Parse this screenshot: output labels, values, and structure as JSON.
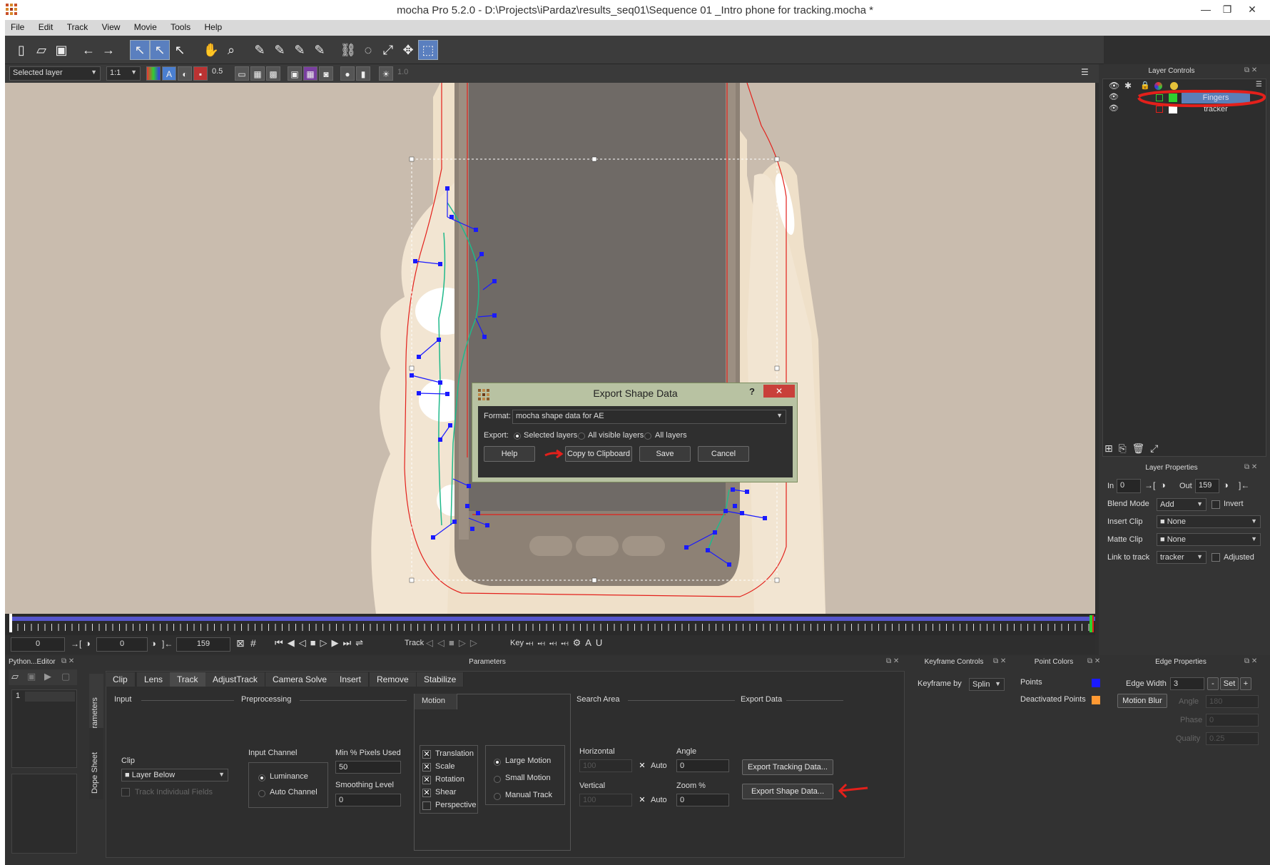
{
  "window": {
    "title": "mocha Pro 5.2.0 - D:\\Projects\\iPardaz\\results_seq01\\Sequence 01 _Intro phone for tracking.mocha *",
    "minimize": "—",
    "maximize": "❐",
    "close": "✕"
  },
  "menu": [
    "File",
    "Edit",
    "Track",
    "View",
    "Movie",
    "Tools",
    "Help"
  ],
  "view_toolbar": {
    "layer_mode": "Selected layer",
    "zoom": "1:1",
    "opacity": "0.5",
    "exposure": "1.0"
  },
  "layer_controls": {
    "title": "Layer Controls",
    "layers": [
      {
        "name": "Fingers",
        "color": "#2fd12f",
        "selected": true
      },
      {
        "name": "tracker",
        "color": "#ffffff",
        "selected": false
      }
    ]
  },
  "layer_properties": {
    "title": "Layer Properties",
    "in_label": "In",
    "in_value": "0",
    "out_label": "Out",
    "out_value": "159",
    "blend_mode_label": "Blend Mode",
    "blend_mode_value": "Add",
    "invert_label": "Invert",
    "insert_clip_label": "Insert Clip",
    "insert_clip_value": "None",
    "matte_clip_label": "Matte Clip",
    "matte_clip_value": "None",
    "link_to_track_label": "Link to track",
    "link_to_track_value": "tracker",
    "adjusted_label": "Adjusted"
  },
  "transport": {
    "start_frame": "0",
    "current_frame": "0",
    "end_frame": "159",
    "track_label": "Track",
    "key_label": "Key"
  },
  "bottom_panels": {
    "python_editor_title": "Python...Editor",
    "python_line": "1",
    "parameters_title": "Parameters",
    "side_tabs": [
      "Parameters",
      "Dope Sheet"
    ],
    "tabs": [
      "Clip",
      "Lens",
      "Track",
      "AdjustTrack",
      "Camera Solve",
      "Insert",
      "Remove",
      "Stabilize"
    ],
    "active_tab": "Track",
    "sections": {
      "input": "Input",
      "preprocessing": "Preprocessing",
      "motion": "Motion",
      "search_area": "Search Area",
      "export_data": "Export Data"
    },
    "clip_label": "Clip",
    "clip_value": "Layer Below",
    "track_individual_fields": "Track Individual Fields",
    "input_channel_label": "Input Channel",
    "luminance": "Luminance",
    "auto_channel": "Auto Channel",
    "min_pixels_label": "Min % Pixels Used",
    "min_pixels_value": "50",
    "smoothing_label": "Smoothing Level",
    "smoothing_value": "0",
    "motion_checks": [
      "Translation",
      "Scale",
      "Rotation",
      "Shear",
      "Perspective"
    ],
    "motion_types": [
      "Large Motion",
      "Small Motion",
      "Manual Track"
    ],
    "horizontal_label": "Horizontal",
    "horizontal_value": "100",
    "vertical_label": "Vertical",
    "vertical_value": "100",
    "auto_label": "Auto",
    "angle_label": "Angle",
    "angle_value": "0",
    "zoom_label": "Zoom %",
    "zoom_value": "0",
    "export_tracking": "Export Tracking Data...",
    "export_shape": "Export Shape Data..."
  },
  "keyframe_controls": {
    "title": "Keyframe Controls",
    "keyframe_by_label": "Keyframe by",
    "keyframe_by_value": "Splin"
  },
  "point_colors": {
    "title": "Point Colors",
    "points_label": "Points",
    "points_color": "#1a1aff",
    "deactivated_label": "Deactivated Points",
    "deactivated_color": "#ff9933"
  },
  "edge_properties": {
    "title": "Edge Properties",
    "edge_width_label": "Edge Width",
    "edge_width_value": "3",
    "minus": "-",
    "set": "Set",
    "plus": "+",
    "motion_blur": "Motion Blur",
    "angle_label": "Angle",
    "angle_value": "180",
    "phase_label": "Phase",
    "phase_value": "0",
    "quality_label": "Quality",
    "quality_value": "0.25"
  },
  "dialog": {
    "title": "Export Shape Data",
    "help_glyph": "?",
    "close_glyph": "✕",
    "format_label": "Format:",
    "format_value": "mocha shape data for AE",
    "export_label": "Export:",
    "options": [
      "Selected layers",
      "All visible layers",
      "All layers"
    ],
    "selected_option": "Selected layers",
    "help_button": "Help",
    "copy_button": "Copy to Clipboard",
    "save_button": "Save",
    "cancel_button": "Cancel"
  },
  "colors": {
    "accent_red": "#e3201b",
    "spline_green": "#1fb98b",
    "point_blue": "#1a1aff",
    "dialog_frame": "#b8c2a2"
  }
}
